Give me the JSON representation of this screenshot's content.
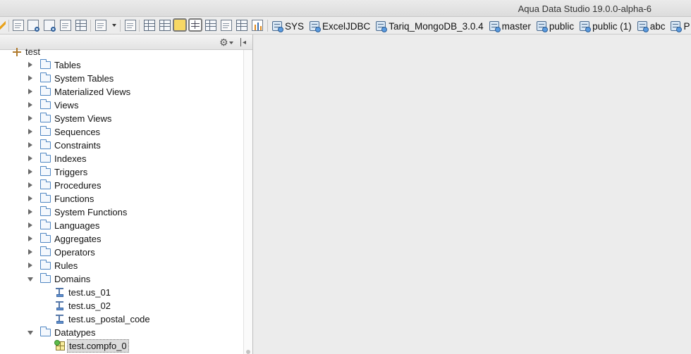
{
  "window": {
    "title": "Aqua Data Studio 19.0.0-alpha-6"
  },
  "toolbar": {
    "icons": [
      "wand-icon",
      "query-icon",
      "compare-icon",
      "search-icon",
      "report-icon",
      "schema-icon",
      "new-file-icon",
      "history-icon",
      "grid-icon",
      "pivot-icon",
      "form-icon",
      "table-icon",
      "tree-icon",
      "list-icon",
      "chart-icon"
    ]
  },
  "servers": [
    "SYS",
    "ExcelJDBC",
    "Tariq_MongoDB_3.0.4",
    "master",
    "public",
    "public (1)",
    "abc",
    "P"
  ],
  "tree": {
    "root": "test",
    "folders": [
      "Tables",
      "System Tables",
      "Materialized Views",
      "Views",
      "System Views",
      "Sequences",
      "Constraints",
      "Indexes",
      "Triggers",
      "Procedures",
      "Functions",
      "System Functions",
      "Languages",
      "Aggregates",
      "Operators",
      "Rules"
    ],
    "domains_label": "Domains",
    "domains": [
      "test.us_01",
      "test.us_02",
      "test.us_postal_code"
    ],
    "datatypes_label": "Datatypes",
    "datatypes": [
      "test.compfo_0"
    ]
  },
  "colors": {
    "folder_accent": "#4f86c2",
    "selection": "#dcdcdc",
    "toolbar_selected": "#f7d865"
  }
}
